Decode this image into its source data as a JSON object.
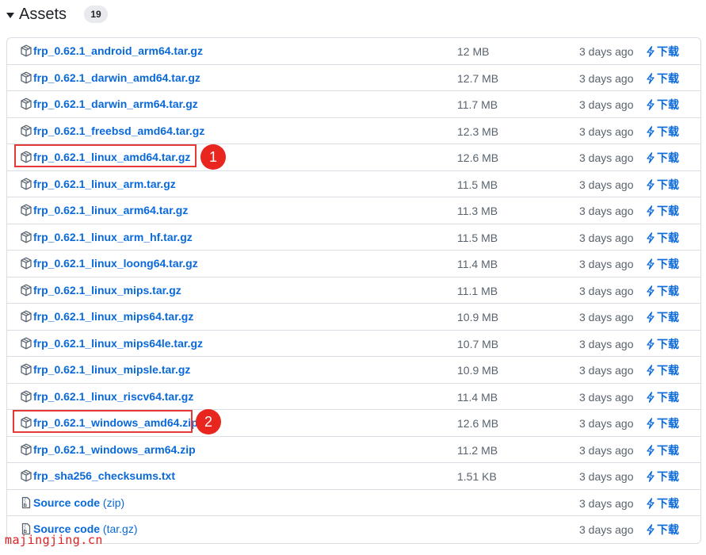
{
  "assets": {
    "title": "Assets",
    "count": "19",
    "download_label": "下载",
    "items": [
      {
        "name": "frp_0.62.1_android_arm64.tar.gz",
        "suffix": "",
        "size": "12 MB",
        "date": "3 days ago",
        "icon": "package-icon"
      },
      {
        "name": "frp_0.62.1_darwin_amd64.tar.gz",
        "suffix": "",
        "size": "12.7 MB",
        "date": "3 days ago",
        "icon": "package-icon"
      },
      {
        "name": "frp_0.62.1_darwin_arm64.tar.gz",
        "suffix": "",
        "size": "11.7 MB",
        "date": "3 days ago",
        "icon": "package-icon"
      },
      {
        "name": "frp_0.62.1_freebsd_amd64.tar.gz",
        "suffix": "",
        "size": "12.3 MB",
        "date": "3 days ago",
        "icon": "package-icon"
      },
      {
        "name": "frp_0.62.1_linux_amd64.tar.gz",
        "suffix": "",
        "size": "12.6 MB",
        "date": "3 days ago",
        "icon": "package-icon"
      },
      {
        "name": "frp_0.62.1_linux_arm.tar.gz",
        "suffix": "",
        "size": "11.5 MB",
        "date": "3 days ago",
        "icon": "package-icon"
      },
      {
        "name": "frp_0.62.1_linux_arm64.tar.gz",
        "suffix": "",
        "size": "11.3 MB",
        "date": "3 days ago",
        "icon": "package-icon"
      },
      {
        "name": "frp_0.62.1_linux_arm_hf.tar.gz",
        "suffix": "",
        "size": "11.5 MB",
        "date": "3 days ago",
        "icon": "package-icon"
      },
      {
        "name": "frp_0.62.1_linux_loong64.tar.gz",
        "suffix": "",
        "size": "11.4 MB",
        "date": "3 days ago",
        "icon": "package-icon"
      },
      {
        "name": "frp_0.62.1_linux_mips.tar.gz",
        "suffix": "",
        "size": "11.1 MB",
        "date": "3 days ago",
        "icon": "package-icon"
      },
      {
        "name": "frp_0.62.1_linux_mips64.tar.gz",
        "suffix": "",
        "size": "10.9 MB",
        "date": "3 days ago",
        "icon": "package-icon"
      },
      {
        "name": "frp_0.62.1_linux_mips64le.tar.gz",
        "suffix": "",
        "size": "10.7 MB",
        "date": "3 days ago",
        "icon": "package-icon"
      },
      {
        "name": "frp_0.62.1_linux_mipsle.tar.gz",
        "suffix": "",
        "size": "10.9 MB",
        "date": "3 days ago",
        "icon": "package-icon"
      },
      {
        "name": "frp_0.62.1_linux_riscv64.tar.gz",
        "suffix": "",
        "size": "11.4 MB",
        "date": "3 days ago",
        "icon": "package-icon"
      },
      {
        "name": "frp_0.62.1_windows_amd64.zip",
        "suffix": "",
        "size": "12.6 MB",
        "date": "3 days ago",
        "icon": "package-icon"
      },
      {
        "name": "frp_0.62.1_windows_arm64.zip",
        "suffix": "",
        "size": "11.2 MB",
        "date": "3 days ago",
        "icon": "package-icon"
      },
      {
        "name": "frp_sha256_checksums.txt",
        "suffix": "",
        "size": "1.51 KB",
        "date": "3 days ago",
        "icon": "package-icon"
      },
      {
        "name": "Source code",
        "suffix": " (zip)",
        "size": "",
        "date": "3 days ago",
        "icon": "file-zip-icon"
      },
      {
        "name": "Source code",
        "suffix": " (tar.gz)",
        "size": "",
        "date": "3 days ago",
        "icon": "file-zip-icon"
      }
    ]
  },
  "annotations": {
    "marker_1": "1",
    "marker_2": "2",
    "highlight_color": "#e53935",
    "marker_color": "#e8251f"
  },
  "watermark": "majingjing.cn",
  "colors": {
    "link": "#0969da",
    "muted": "#59636e",
    "border": "#d8dee4"
  }
}
